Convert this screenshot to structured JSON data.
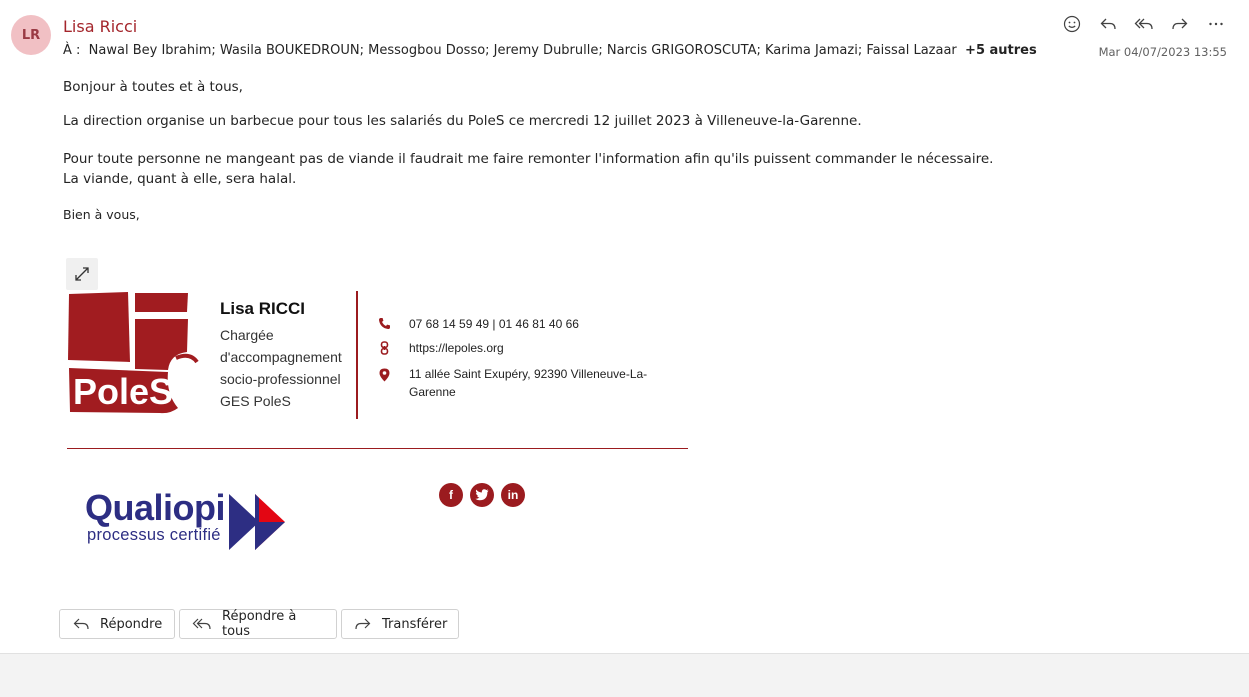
{
  "header": {
    "avatar_initials": "LR",
    "sender": "Lisa Ricci",
    "to_prefix": "À :",
    "recipients": "Nawal Bey Ibrahim;  Wasila BOUKEDROUN;  Messogbou Dosso;  Jeremy Dubrulle;  Narcis GRIGOROSCUTA;  Karima Jamazi;  Faissal Lazaar",
    "more_recipients": "+5 autres",
    "date": "Mar 04/07/2023 13:55",
    "toolbar_icons": [
      "emoji-icon",
      "reply-icon",
      "reply-all-icon",
      "forward-icon",
      "more-icon"
    ]
  },
  "message": {
    "greeting": "Bonjour à toutes et à tous,",
    "p1": "La direction organise un barbecue pour tous les salariés du PoleS ce mercredi 12 juillet 2023 à Villeneuve-la-Garenne.",
    "p2_line1": "Pour toute personne ne mangeant pas de viande il faudrait me faire remonter l'information afin qu'ils puissent commander le nécessaire.",
    "p2_line2": "La viande, quant à elle, sera halal.",
    "closing": "Bien à vous,"
  },
  "signature": {
    "logo_text": "PoleS",
    "name": "Lisa RICCI",
    "role_line1": "Chargée",
    "role_line2": "d'accompagnement",
    "role_line3": "socio-professionnel",
    "role_line4": "GES PoleS",
    "phone": "07 68 14 59 49 | 01 46 81 40 66",
    "website": "https://lepoles.org",
    "address_line1": "11 allée Saint Exupéry, 92390 Villeneuve-La-",
    "address_line2": "Garenne",
    "social": [
      "f",
      "t",
      "in"
    ],
    "qualiopi_word": "Qualiopi",
    "qualiopi_sub": "processus certifié",
    "accent_color": "#9b1b1f"
  },
  "actions": {
    "reply": "Répondre",
    "reply_all": "Répondre à tous",
    "forward": "Transférer"
  }
}
